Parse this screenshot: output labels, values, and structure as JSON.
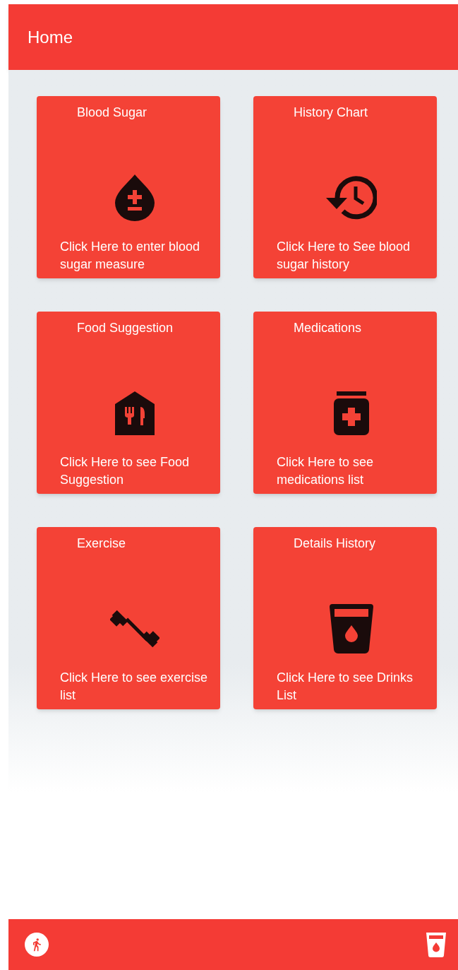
{
  "app_bar": {
    "title": "Home"
  },
  "cards": [
    {
      "title": "Blood Sugar",
      "description": "Click Here to enter blood sugar measure"
    },
    {
      "title": "History Chart",
      "description": "Click Here to See blood sugar history"
    },
    {
      "title": "Food Suggestion",
      "description": "Click Here to see Food Suggestion"
    },
    {
      "title": "Medications",
      "description": "Click Here to see medications list"
    },
    {
      "title": "Exercise",
      "description": "Click Here to see exercise list"
    },
    {
      "title": "Details History",
      "description": "Click Here to see Drinks List"
    }
  ]
}
